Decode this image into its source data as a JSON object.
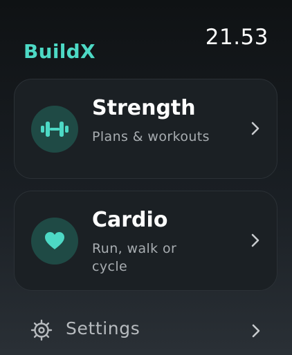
{
  "app": {
    "title": "BuildX",
    "time": "21.53",
    "accent_color": "#4dd9c5"
  },
  "cards": [
    {
      "title": "Strength",
      "subtitle": "Plans & workouts",
      "icon": "dumbbell-icon"
    },
    {
      "title": "Cardio",
      "subtitle": "Run, walk or cycle",
      "icon": "heart-icon"
    }
  ],
  "settings": {
    "label": "Settings",
    "icon": "gear-icon"
  }
}
